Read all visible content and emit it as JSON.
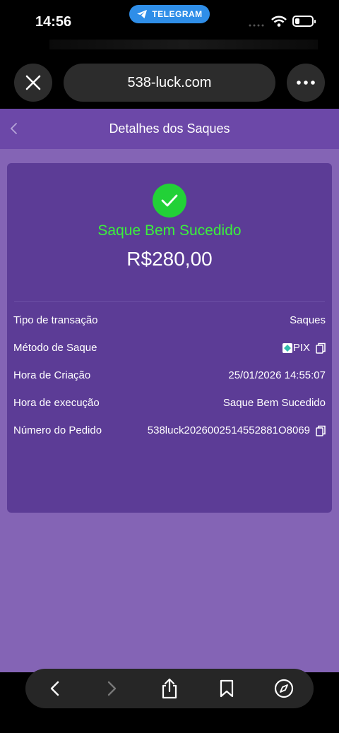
{
  "status_bar": {
    "time": "14:56",
    "source_app": "TELEGRAM",
    "icons": [
      "signal-icon",
      "wifi-icon",
      "battery-icon"
    ]
  },
  "browser": {
    "url": "538-luck.com",
    "close_icon": "close-icon",
    "more_icon": "more-icon"
  },
  "page": {
    "title": "Detalhes dos Saques",
    "status_text": "Saque Bem Sucedido",
    "amount": "R$280,00",
    "details": [
      {
        "label": "Tipo de transação",
        "value": "Saques"
      },
      {
        "label": "Método de Saque",
        "value": "PIX"
      },
      {
        "label": "Hora de Criação",
        "value": "25/01/2026 14:55:07"
      },
      {
        "label": "Hora de execução",
        "value": "Saque Bem Sucedido"
      },
      {
        "label": "Número do Pedido",
        "value": "538luck2026002514552881O8069"
      }
    ]
  },
  "colors": {
    "header_bg": "#6c48a8",
    "page_bg": "#8464b5",
    "card_bg": "#5c3c96",
    "success_green": "#3bf03b",
    "telegram_blue": "#2f8ee8"
  },
  "toolbar": {
    "items": [
      "back-icon",
      "forward-icon",
      "share-icon",
      "bookmark-icon",
      "compass-icon"
    ]
  }
}
